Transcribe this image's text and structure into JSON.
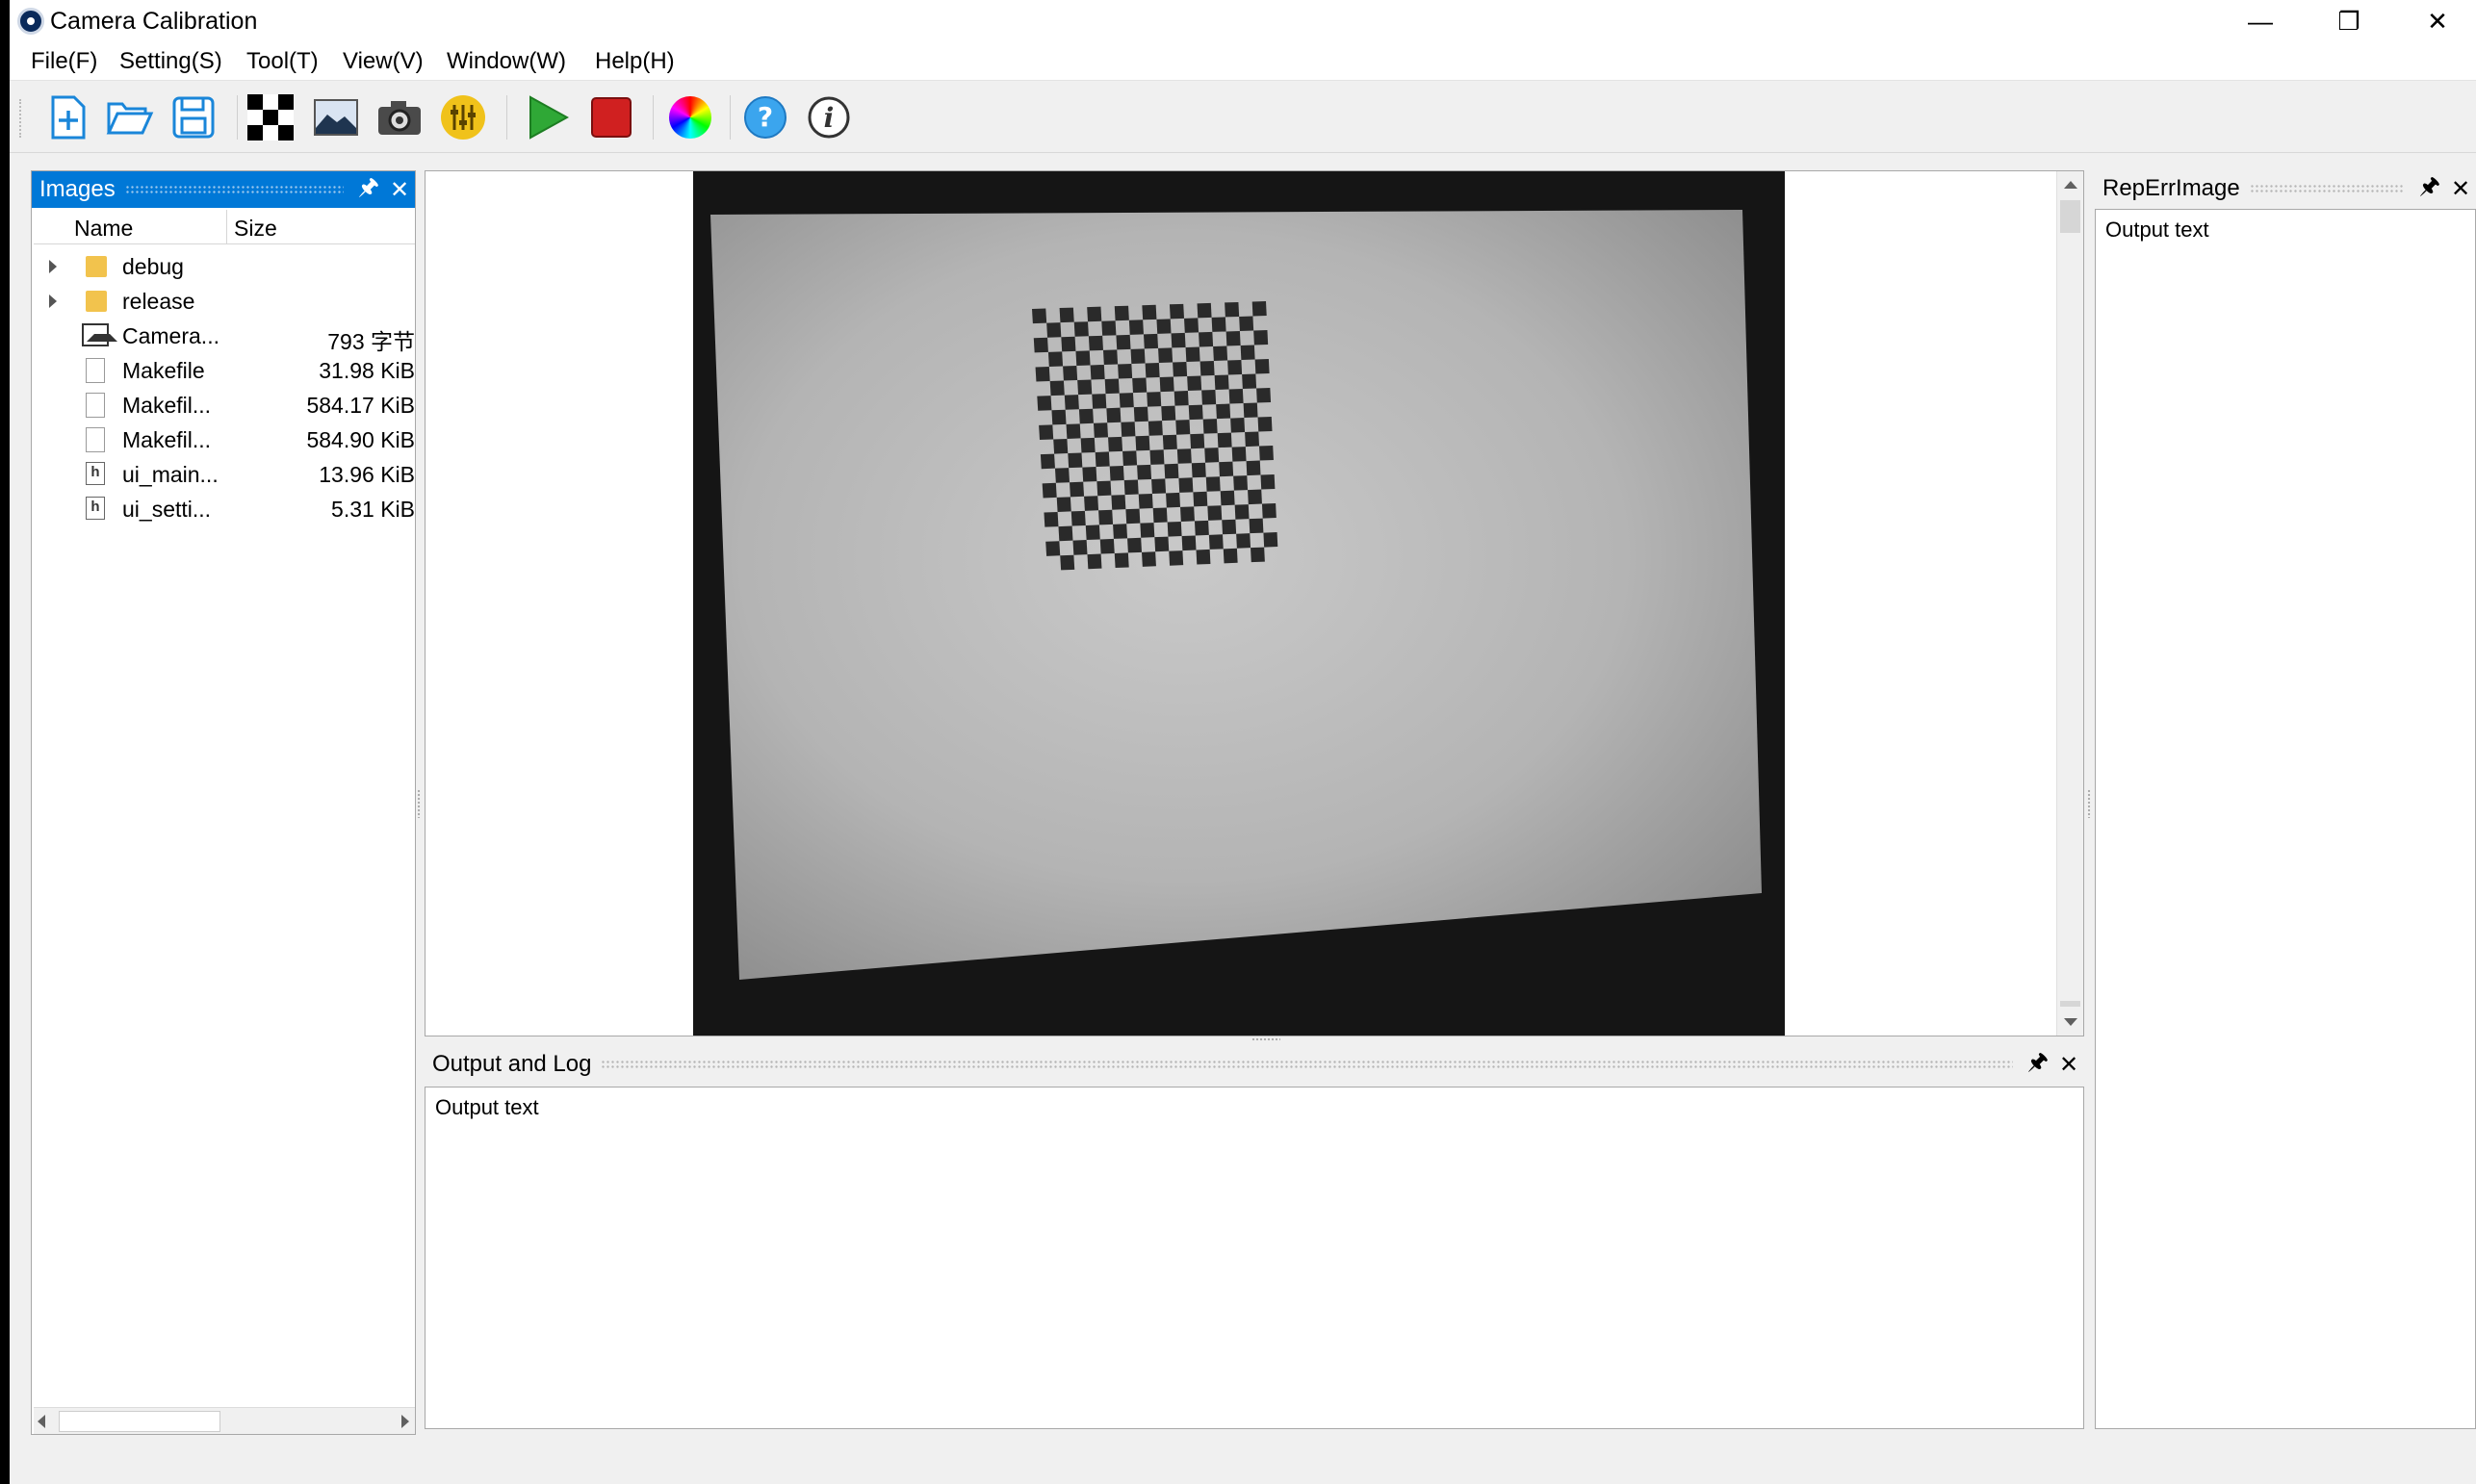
{
  "window": {
    "title": "Camera Calibration",
    "controls": {
      "minimize": "—",
      "maximize": "❐",
      "close": "✕"
    }
  },
  "menu": {
    "items": [
      "File(F)",
      "Setting(S)",
      "Tool(T)",
      "View(V)",
      "Window(W)",
      "Help(H)"
    ]
  },
  "toolbar": {
    "buttons": [
      "new-icon",
      "open-folder-icon",
      "save-icon",
      "chessboard-icon",
      "image-icon",
      "camera-icon",
      "settings-sliders-icon",
      "run-icon",
      "stop-icon",
      "color-wheel-icon",
      "help-icon",
      "info-icon"
    ],
    "colors": {
      "run": "#2fa836",
      "stop": "#d02020",
      "accent": "#0078d7"
    }
  },
  "images_panel": {
    "title": "Images",
    "pin": "🖈",
    "close": "✕",
    "columns": {
      "name": "Name",
      "size": "Size"
    },
    "rows": [
      {
        "name": "debug",
        "size": "",
        "icon": "folder-icon"
      },
      {
        "name": "release",
        "size": "",
        "icon": "folder-icon"
      },
      {
        "name": "Camera...",
        "size": "793 字节",
        "icon": "image-icon"
      },
      {
        "name": "Makefile",
        "size": "31.98 KiB",
        "icon": "file-icon"
      },
      {
        "name": "Makefil...",
        "size": "584.17 KiB",
        "icon": "file-icon"
      },
      {
        "name": "Makefil...",
        "size": "584.90 KiB",
        "icon": "file-icon"
      },
      {
        "name": "ui_main...",
        "size": "13.96 KiB",
        "icon": "header-file-icon"
      },
      {
        "name": "ui_setti...",
        "size": "5.31 KiB",
        "icon": "header-file-icon"
      }
    ]
  },
  "output_log": {
    "title": "Output and Log",
    "pin": "🖈",
    "close": "✕",
    "text": "Output text"
  },
  "rep_err_panel": {
    "title": "RepErrImage",
    "pin": "🖈",
    "close": "✕",
    "text": "Output text"
  }
}
